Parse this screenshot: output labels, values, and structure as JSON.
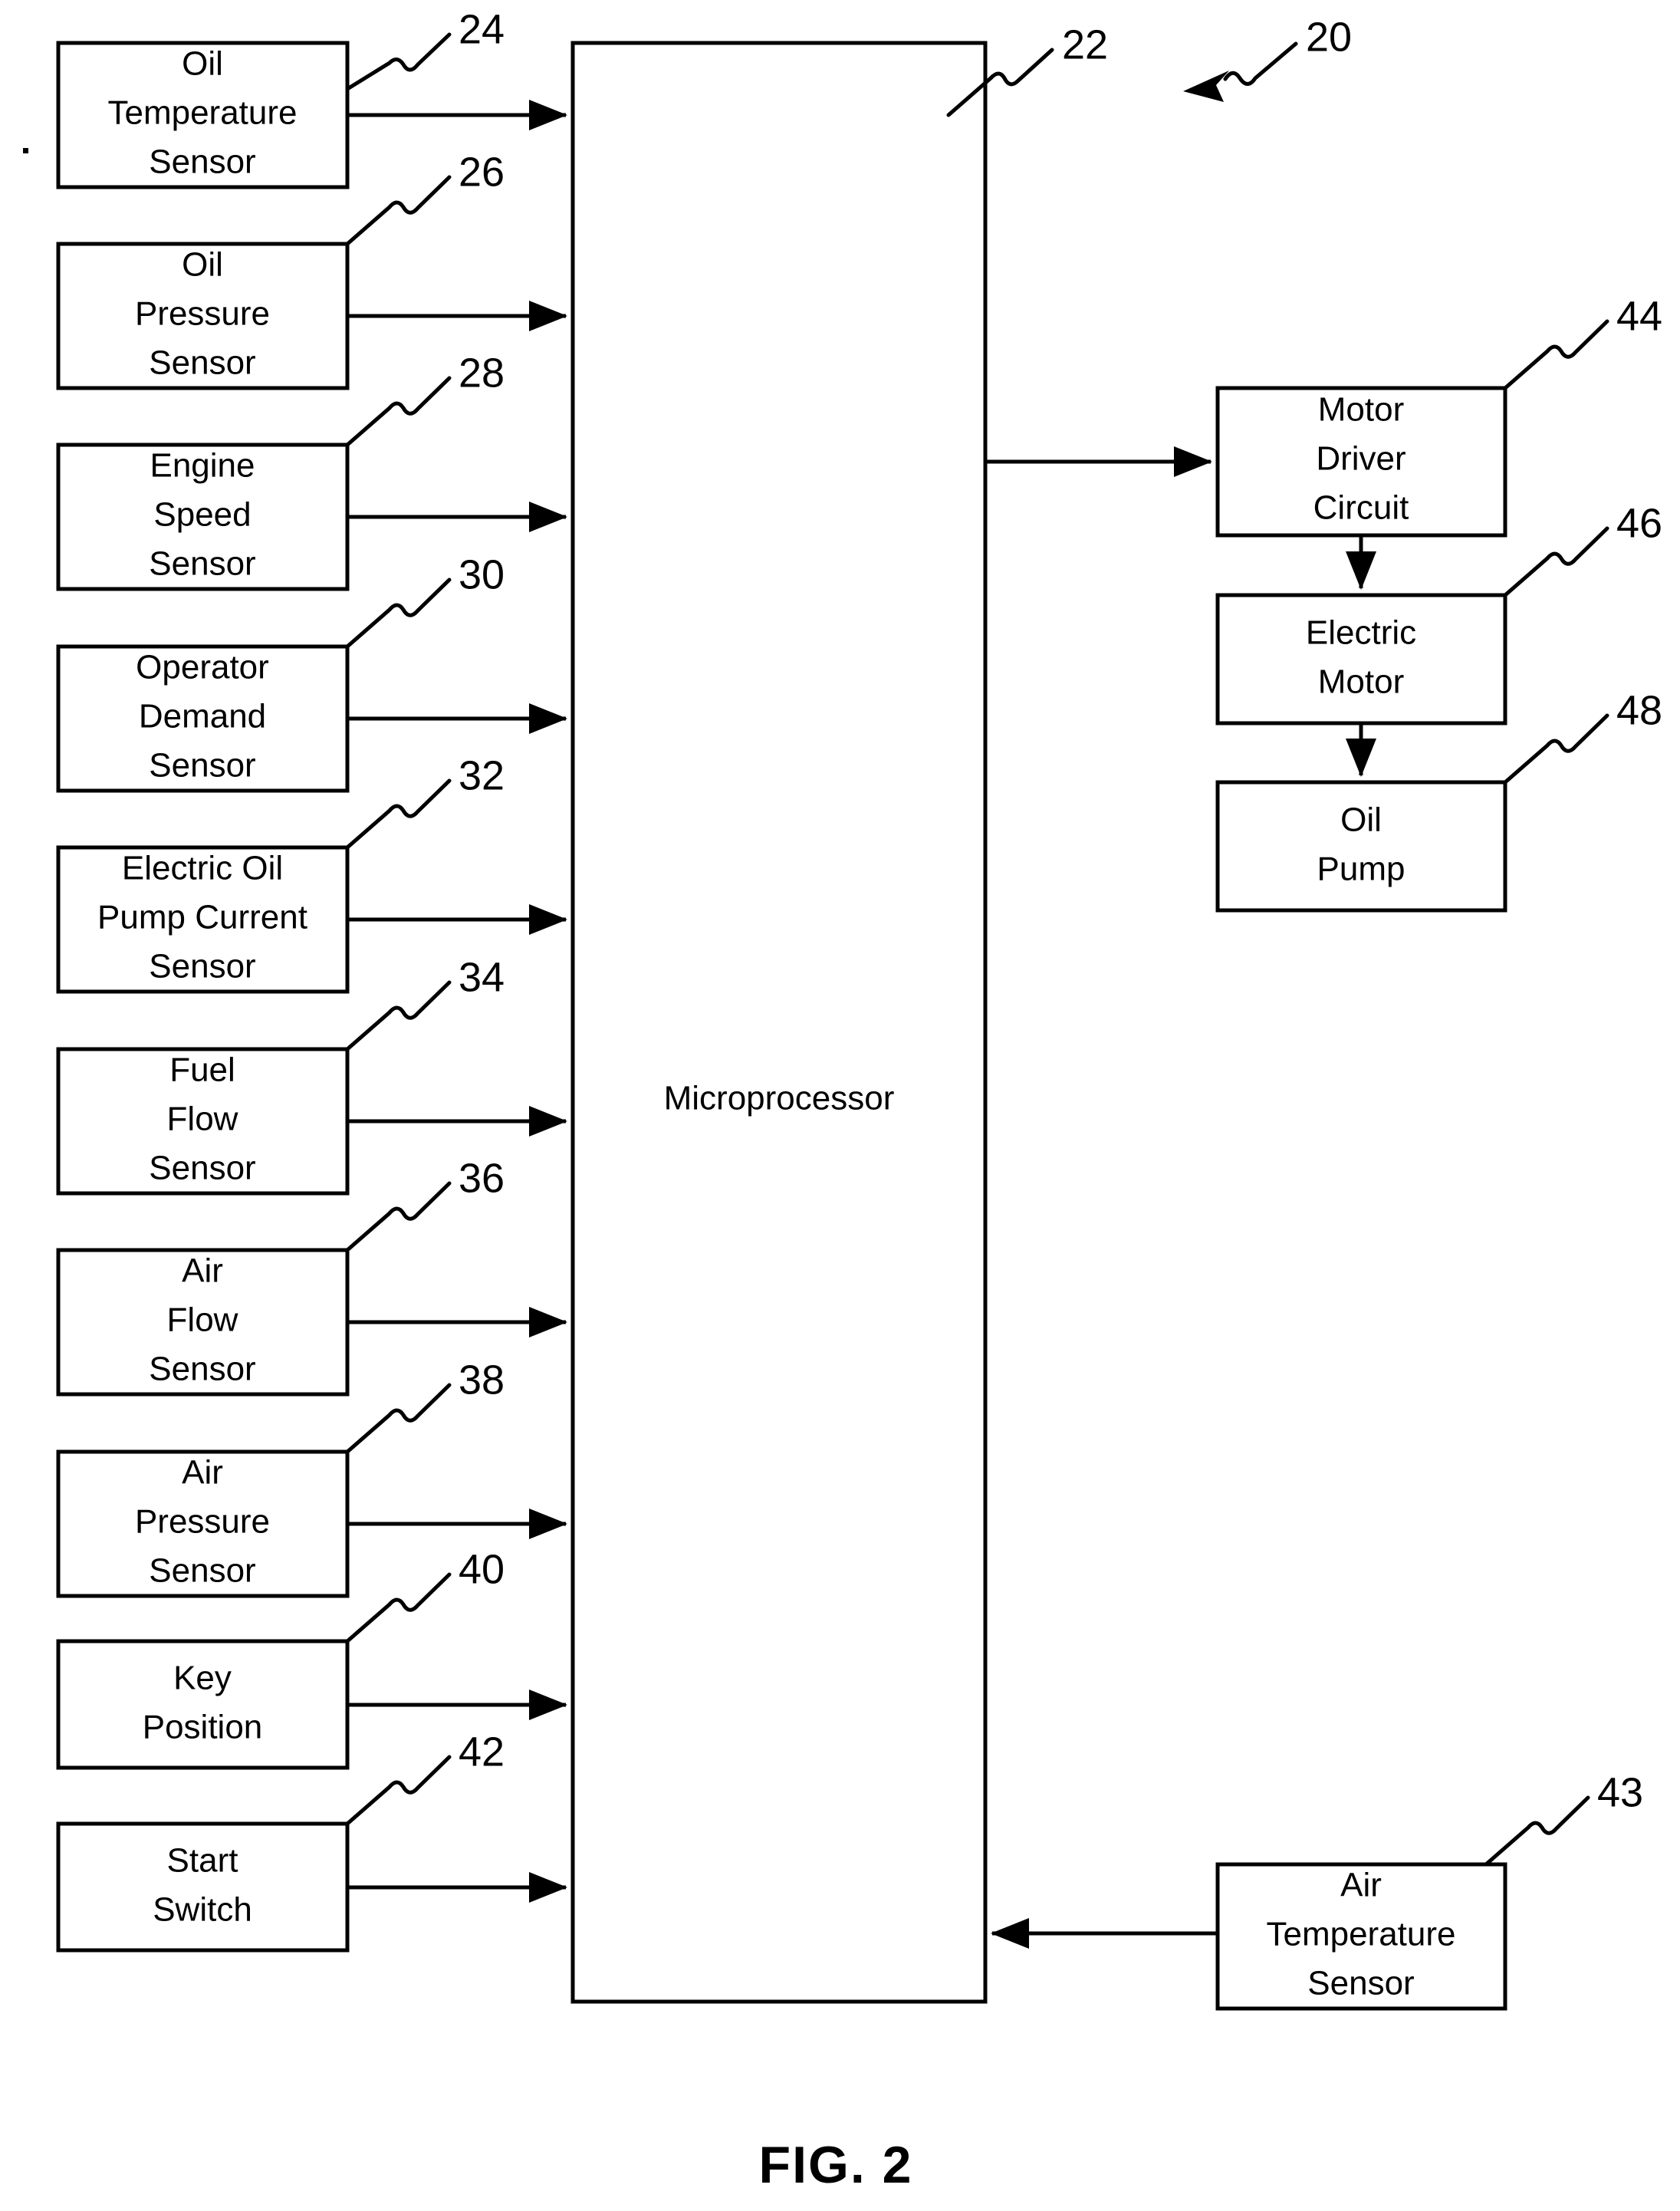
{
  "figure": {
    "caption": "FIG. 2",
    "system_ref": "20"
  },
  "controller": {
    "label": "Microprocessor",
    "ref": "22"
  },
  "inputs": [
    {
      "label_lines": [
        "Oil",
        "Temperature",
        "Sensor"
      ],
      "ref": "24"
    },
    {
      "label_lines": [
        "Oil",
        "Pressure",
        "Sensor"
      ],
      "ref": "26"
    },
    {
      "label_lines": [
        "Engine",
        "Speed",
        "Sensor"
      ],
      "ref": "28"
    },
    {
      "label_lines": [
        "Operator",
        "Demand",
        "Sensor"
      ],
      "ref": "30"
    },
    {
      "label_lines": [
        "Electric Oil",
        "Pump Current",
        "Sensor"
      ],
      "ref": "32"
    },
    {
      "label_lines": [
        "Fuel",
        "Flow",
        "Sensor"
      ],
      "ref": "34"
    },
    {
      "label_lines": [
        "Air",
        "Flow",
        "Sensor"
      ],
      "ref": "36"
    },
    {
      "label_lines": [
        "Air",
        "Pressure",
        "Sensor"
      ],
      "ref": "38"
    },
    {
      "label_lines": [
        "Key",
        "Position"
      ],
      "ref": "40"
    },
    {
      "label_lines": [
        "Start",
        "Switch"
      ],
      "ref": "42"
    }
  ],
  "right_input": {
    "label_lines": [
      "Air",
      "Temperature",
      "Sensor"
    ],
    "ref": "43"
  },
  "outputs": [
    {
      "label_lines": [
        "Motor",
        "Driver",
        "Circuit"
      ],
      "ref": "44"
    },
    {
      "label_lines": [
        "Electric",
        "Motor"
      ],
      "ref": "46"
    },
    {
      "label_lines": [
        "Oil",
        "Pump"
      ],
      "ref": "48"
    }
  ],
  "colors": {
    "ink": "#000000",
    "paper": "#ffffff"
  }
}
